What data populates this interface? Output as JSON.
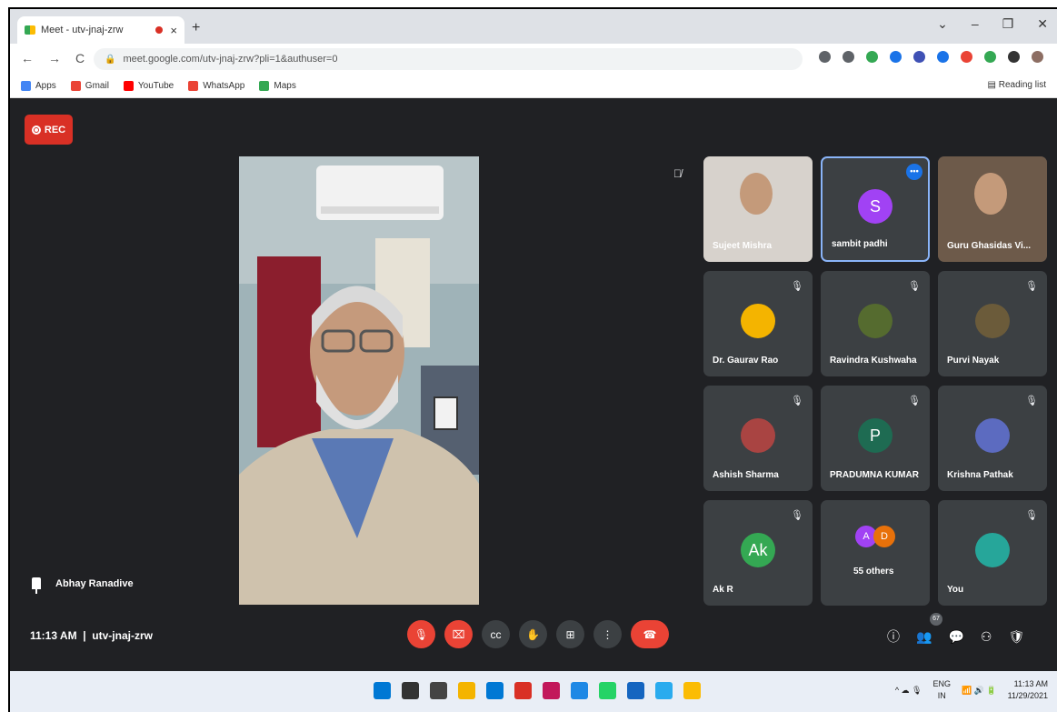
{
  "browser": {
    "tab_title": "Meet - utv-jnaj-zrw",
    "tab_close": "×",
    "new_tab": "+",
    "window_controls": [
      "⌄",
      "–",
      "❐",
      "✕"
    ],
    "url": "meet.google.com/utv-jnaj-zrw?pli=1&authuser=0",
    "nav": [
      "←",
      "→",
      "C"
    ],
    "bookmarks": [
      {
        "label": "Apps",
        "icon": "apps-grid-icon",
        "color": "#4285f4"
      },
      {
        "label": "Gmail",
        "icon": "gmail-icon",
        "color": "#ea4335"
      },
      {
        "label": "YouTube",
        "icon": "youtube-icon",
        "color": "#ff0000"
      },
      {
        "label": "WhatsApp",
        "icon": "whatsapp-icon",
        "color": "#ea4335"
      },
      {
        "label": "Maps",
        "icon": "maps-icon",
        "color": "#34a853"
      }
    ],
    "reading_list": "Reading list",
    "extension_colors": [
      "#5f6368",
      "#5f6368",
      "#34a853",
      "#1a73e8",
      "#3f51b5",
      "#1a73e8",
      "#ea4335",
      "#34a853",
      "#333333",
      "#8d6e63"
    ]
  },
  "meet": {
    "rec_label": "REC",
    "presenter_name": "Abhay Ranadive",
    "clock": "11:13 AM",
    "meeting_code": "utv-jnaj-zrw",
    "people_count": "67",
    "participants": [
      {
        "name": "Sujeet Mishra",
        "type": "video",
        "color": "#d7d2cc"
      },
      {
        "name": "sambit padhi",
        "type": "avatar",
        "initial": "S",
        "color": "#a142f4",
        "active": true
      },
      {
        "name": "Guru Ghasidas Vi...",
        "type": "video",
        "color": "#6d5a4a"
      },
      {
        "name": "Dr. Gaurav Rao",
        "type": "photo",
        "color": "#f4b400"
      },
      {
        "name": "Ravindra Kushwaha",
        "type": "photo",
        "color": "#556b2f"
      },
      {
        "name": "Purvi Nayak",
        "type": "photo",
        "color": "#6b5b3a"
      },
      {
        "name": "Ashish Sharma",
        "type": "photo",
        "color": "#a94442"
      },
      {
        "name": "PRADUMNA KUMAR",
        "type": "avatar",
        "initial": "P",
        "color": "#1e6b52"
      },
      {
        "name": "Krishna Pathak",
        "type": "photo",
        "color": "#5c6bc0"
      },
      {
        "name": "Ak R",
        "type": "avatar",
        "initial": "Ak",
        "color": "#34a853"
      },
      {
        "name": "55 others",
        "type": "others",
        "initials": [
          "A",
          "D"
        ],
        "colors": [
          "#a142f4",
          "#e8710a"
        ]
      },
      {
        "name": "You",
        "type": "photo",
        "color": "#26a69a"
      }
    ],
    "controls": [
      {
        "name": "mic-off-button",
        "glyph": "🎙",
        "red": true
      },
      {
        "name": "camera-off-button",
        "glyph": "⌧",
        "red": true
      },
      {
        "name": "captions-button",
        "glyph": "cc",
        "red": false
      },
      {
        "name": "raise-hand-button",
        "glyph": "✋",
        "red": false
      },
      {
        "name": "present-button",
        "glyph": "⊞",
        "red": false
      },
      {
        "name": "more-options-button",
        "glyph": "⋮",
        "red": false
      }
    ],
    "end_call_glyph": "☎",
    "right_controls": [
      "ⓘ",
      "👥",
      "💬",
      "⚇",
      "🛡"
    ]
  },
  "taskbar": {
    "icon_colors": [
      "#0078d4",
      "#333333",
      "#444444",
      "#f4b400",
      "#0078d4",
      "#d93025",
      "#c2185b",
      "#1e88e5",
      "#25d366",
      "#1565c0",
      "#2aabee",
      "#fbbc04"
    ],
    "lang_top": "ENG",
    "lang_bottom": "IN",
    "time": "11:13 AM",
    "date": "11/29/2021",
    "tray_glyphs": "^ ☁ 🎙"
  }
}
